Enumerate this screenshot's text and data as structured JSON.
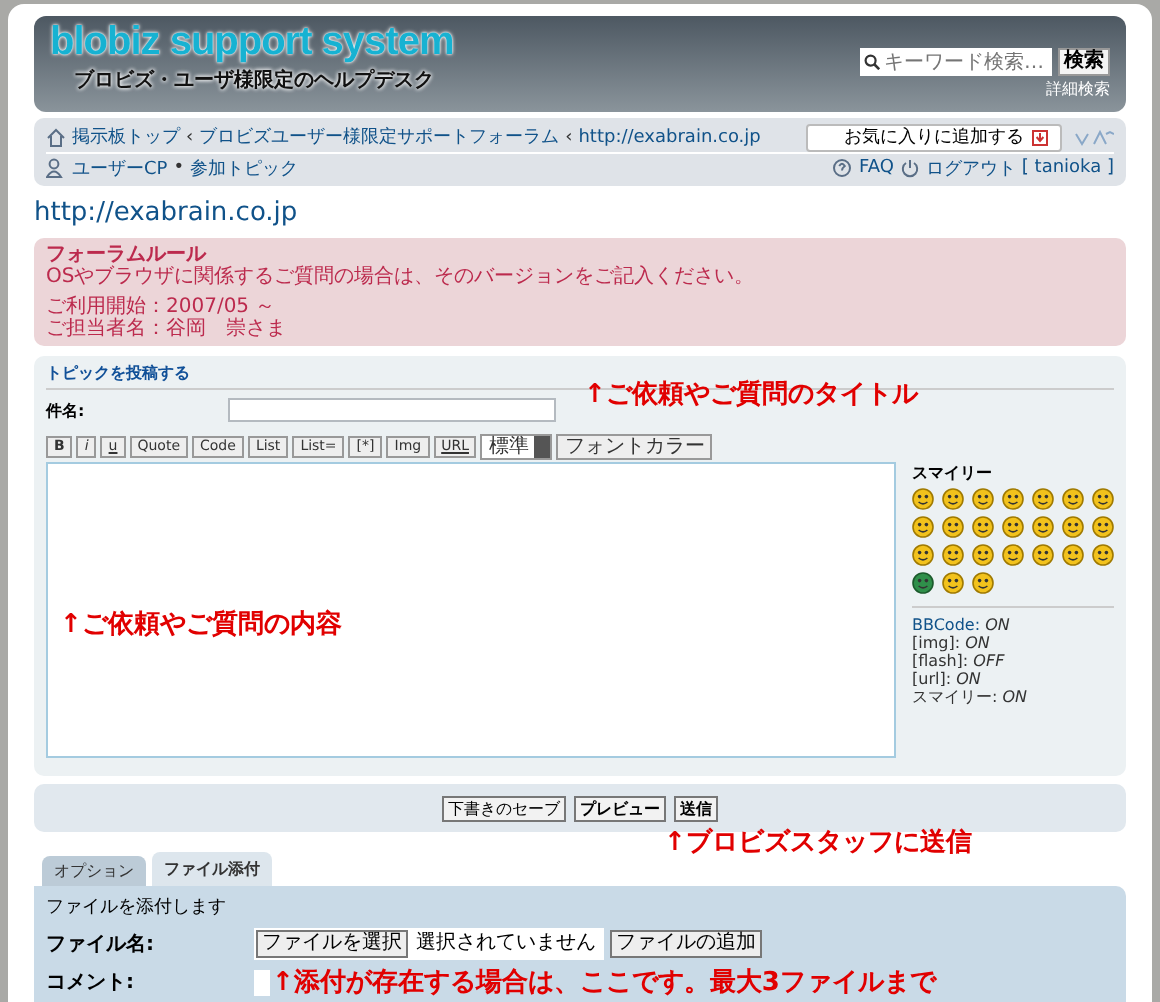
{
  "header": {
    "title": "blobiz support system",
    "subtitle": "ブロビズ・ユーザ様限定のヘルプデスク",
    "search": {
      "placeholder": "キーワード検索…",
      "button": "検索",
      "advanced": "詳細検索"
    }
  },
  "nav": {
    "breadcrumbs": [
      "掲示板トップ",
      "ブロビズユーザー様限定サポートフォーラム",
      "http://exabrain.co.jp"
    ],
    "separator": "‹",
    "bookmark_button": "お気に入りに追加する",
    "user_links": [
      "ユーザーCP",
      "参加トピック"
    ],
    "bullet": "•",
    "faq": "FAQ",
    "logout": "ログアウト",
    "username": "[ tanioka ]"
  },
  "page_title": "http://exabrain.co.jp",
  "rules": {
    "title": "フォーラムルール",
    "paragraphs": [
      [
        "OSやブラウザに関係するご質問の場合は、そのバージョンをご記入ください。"
      ],
      [
        "ご利用開始：2007/05 ～",
        "ご担当者名：谷岡　崇さま"
      ]
    ]
  },
  "post_form": {
    "heading": "トピックを投稿する",
    "subject_label": "件名:",
    "toolbar": [
      {
        "label": "B",
        "kind": "bold"
      },
      {
        "label": "i",
        "kind": "italic"
      },
      {
        "label": "u",
        "kind": "underline"
      },
      {
        "label": "Quote",
        "kind": "button"
      },
      {
        "label": "Code",
        "kind": "button"
      },
      {
        "label": "List",
        "kind": "button"
      },
      {
        "label": "List=",
        "kind": "button"
      },
      {
        "label": "[*]",
        "kind": "button"
      },
      {
        "label": "Img",
        "kind": "button"
      },
      {
        "label": "URL",
        "kind": "underline"
      },
      {
        "label": "標準",
        "kind": "select"
      },
      {
        "label": "フォントカラー",
        "kind": "button"
      }
    ],
    "smilies_title": "スマイリー",
    "smilies": [
      {
        "kind": "yellow"
      },
      {
        "kind": "yellow"
      },
      {
        "kind": "yellow"
      },
      {
        "kind": "yellow"
      },
      {
        "kind": "yellow"
      },
      {
        "kind": "yellow"
      },
      {
        "kind": "yellow"
      },
      {
        "kind": "yellow"
      },
      {
        "kind": "yellow"
      },
      {
        "kind": "yellow"
      },
      {
        "kind": "yellow"
      },
      {
        "kind": "yellow"
      },
      {
        "kind": "yellow"
      },
      {
        "kind": "yellow"
      },
      {
        "kind": "yellow"
      },
      {
        "kind": "yellow"
      },
      {
        "kind": "yellow"
      },
      {
        "kind": "yellow"
      },
      {
        "kind": "yellow"
      },
      {
        "kind": "yellow"
      },
      {
        "kind": "yellow"
      },
      {
        "kind": "green"
      },
      {
        "kind": "yellow"
      },
      {
        "kind": "yellow"
      }
    ],
    "status": [
      {
        "label": "BBCode:",
        "value": "ON",
        "kind": "link"
      },
      {
        "label": "[img]:",
        "value": "ON",
        "kind": "text"
      },
      {
        "label": "[flash]:",
        "value": "OFF",
        "kind": "text"
      },
      {
        "label": "[url]:",
        "value": "ON",
        "kind": "text"
      },
      {
        "label": "スマイリー:",
        "value": "ON",
        "kind": "text"
      }
    ]
  },
  "actions": [
    {
      "label": "下書きのセーブ",
      "primary": false
    },
    {
      "label": "プレビュー",
      "primary": true
    },
    {
      "label": "送信",
      "primary": true
    }
  ],
  "tabs": [
    {
      "label": "オプション",
      "selected": false
    },
    {
      "label": "ファイル添付",
      "selected": true
    }
  ],
  "attachments": {
    "intro": "ファイルを添付します",
    "file_label": "ファイル名:",
    "choose_button": "ファイルを選択",
    "no_file": "選択されていません",
    "add_button": "ファイルの追加",
    "comment_label": "コメント:"
  },
  "annotations": [
    {
      "text": "↑ご依頼やご質問のタイトル"
    },
    {
      "text": "↑ご依頼やご質問の内容"
    },
    {
      "text": "↑ブロビズスタッフに送信"
    },
    {
      "text": "↑添付が存在する場合は、ここです。最大3ファイルまで"
    }
  ]
}
